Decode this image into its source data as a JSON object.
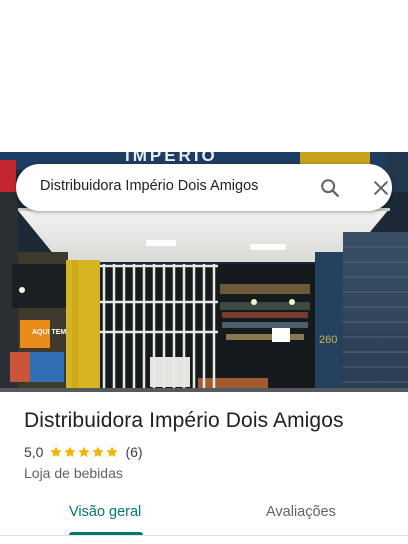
{
  "search": {
    "query": "Distribuidora Império Dois Amigos"
  },
  "hero": {
    "sign_text": "IMPÉRIO",
    "shop_window_text": "AQUI TEM",
    "pillar_number": "260"
  },
  "place": {
    "name": "Distribuidora Império Dois Amigos",
    "rating": "5,0",
    "review_count": "(6)",
    "stars_filled": 5,
    "category": "Loja de bebidas"
  },
  "tabs": [
    {
      "label": "Visão geral",
      "active": true
    },
    {
      "label": "Avaliações",
      "active": false
    }
  ],
  "colors": {
    "accent": "#00796b",
    "star": "#f4b400",
    "text_primary": "#202124",
    "text_secondary": "#5f6368"
  },
  "icons": {
    "search": "search-icon",
    "close": "close-icon",
    "star": "star-icon"
  }
}
